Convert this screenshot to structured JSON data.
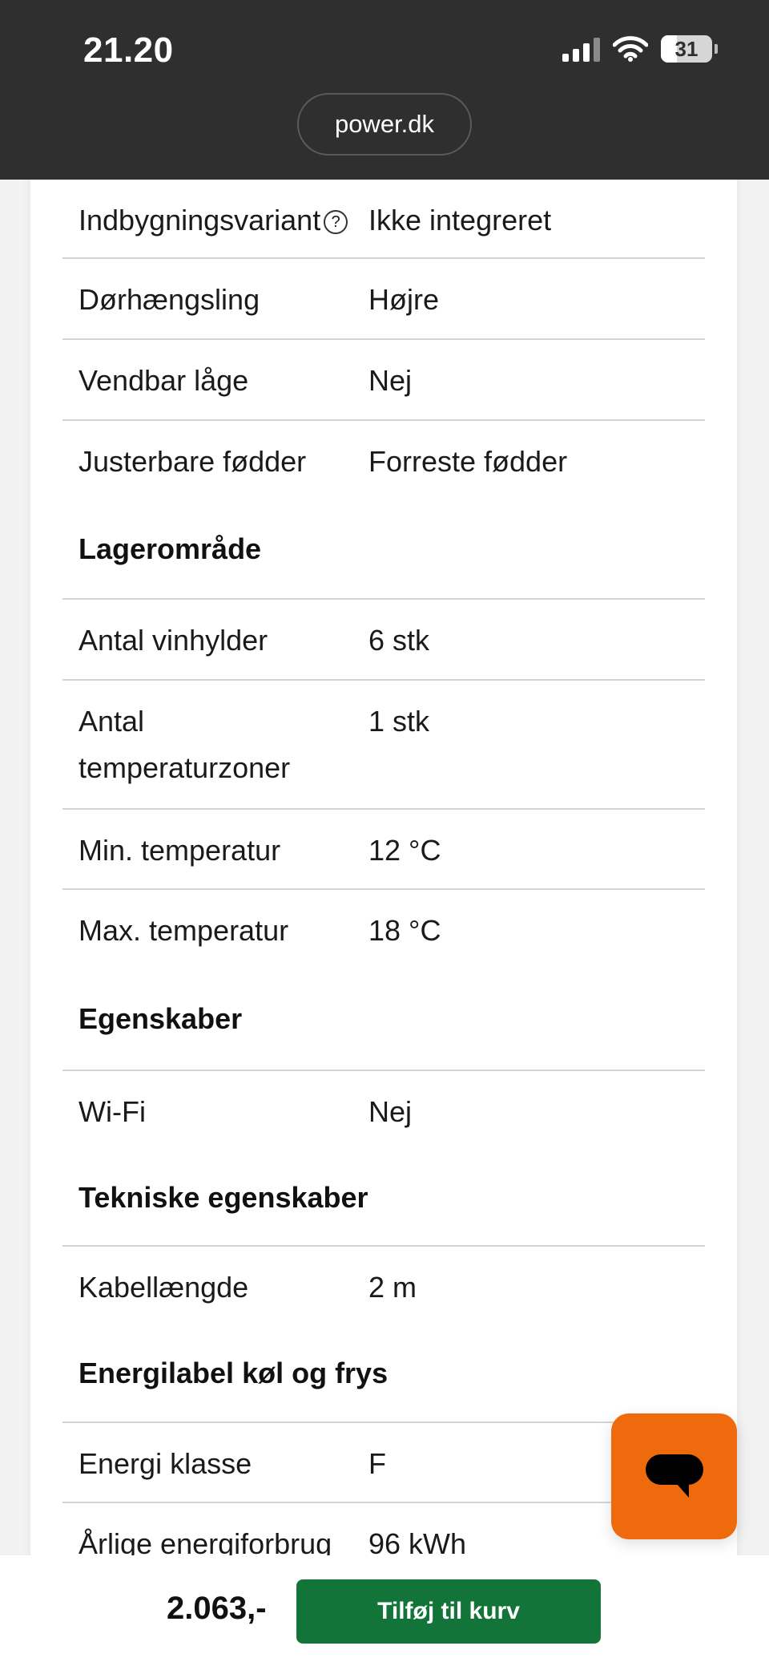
{
  "status_bar": {
    "time": "21.20",
    "battery_level": "31"
  },
  "browser": {
    "url": "power.dk"
  },
  "specs": {
    "row_mounting": {
      "label": "Indbygningsvariant",
      "value": "Ikke integreret"
    },
    "row_hinge": {
      "label": "Dørhængsling",
      "value": "Højre"
    },
    "row_reversible": {
      "label": "Vendbar låge",
      "value": "Nej"
    },
    "row_feet": {
      "label": "Justerbare fødder",
      "value": "Forreste fødder"
    },
    "storage": {
      "heading": "Lagerområde",
      "shelves": {
        "label": "Antal vinhylder",
        "value": "6 stk"
      },
      "zones": {
        "label_line1": "Antal",
        "label_line2": "temperaturzoner",
        "value": "1 stk"
      },
      "min_temp": {
        "label": "Min. temperatur",
        "value": "12 °C"
      },
      "max_temp": {
        "label": "Max. temperatur",
        "value": "18 °C"
      }
    },
    "features": {
      "heading": "Egenskaber",
      "wifi": {
        "label": "Wi-Fi",
        "value": "Nej"
      }
    },
    "technical": {
      "heading": "Tekniske egenskaber",
      "cable": {
        "label": "Kabellængde",
        "value": "2 m"
      }
    },
    "energy": {
      "heading": "Energilabel køl og frys",
      "class": {
        "label": "Energi klasse",
        "value": "F"
      },
      "annual": {
        "label": "Årlige energiforbrug",
        "value": "96 kWh"
      }
    }
  },
  "cart": {
    "price": "2.063,-",
    "button_label": "Tilføj til kurv"
  },
  "colors": {
    "accent_orange": "#ee6a0c",
    "cart_green": "#13743a",
    "status_bar": "#2f2f2f"
  },
  "icons": {
    "chat": "chat-bubble-icon",
    "help": "help-circle-icon"
  }
}
